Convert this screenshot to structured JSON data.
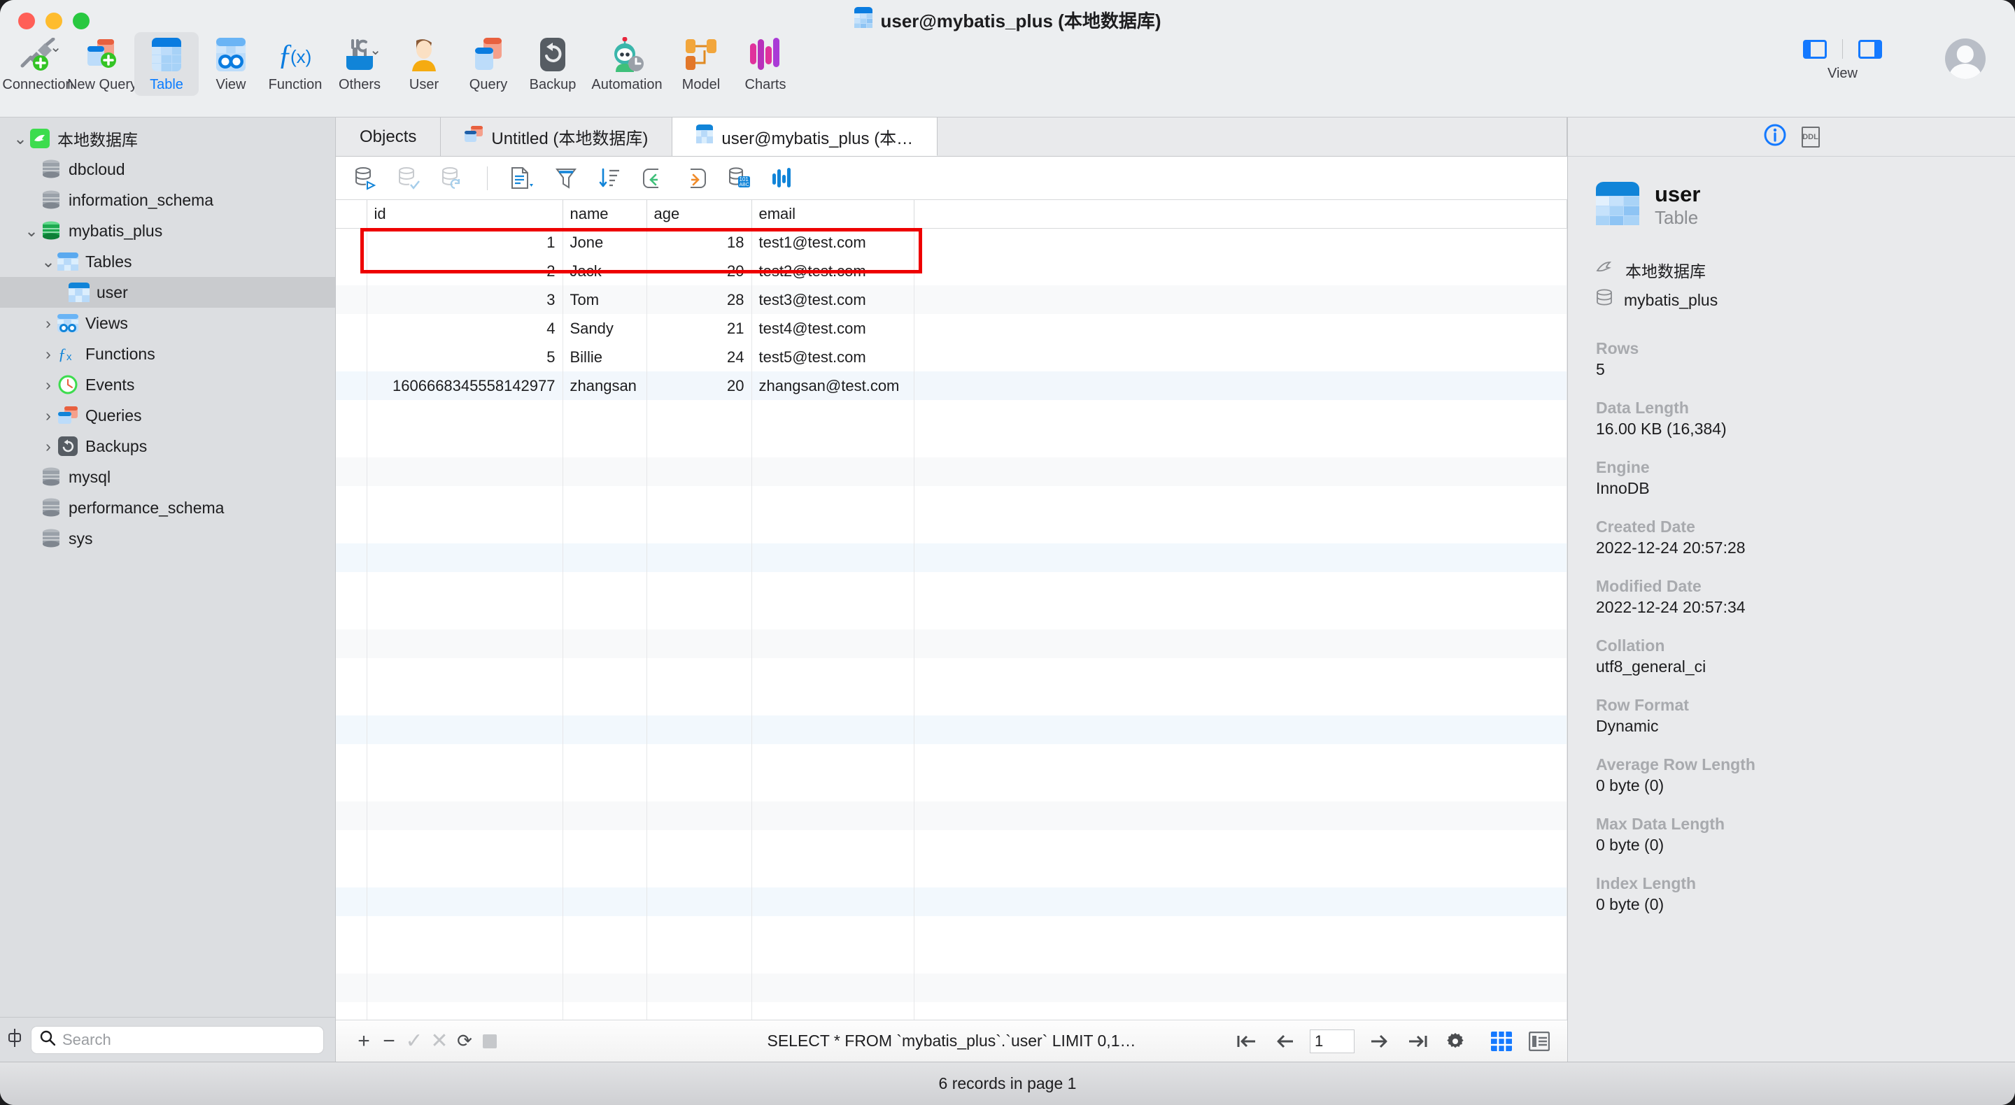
{
  "window": {
    "title": "user@mybatis_plus (本地数据库)",
    "title_icon": "table-icon"
  },
  "toolbar": {
    "items": [
      {
        "label": "Connection",
        "icon": "connection-plug-icon",
        "selected": false,
        "has_chevron": true
      },
      {
        "label": "New Query",
        "icon": "new-query-icon",
        "selected": false,
        "has_chevron": false
      },
      {
        "label": "Table",
        "icon": "table-icon",
        "selected": true,
        "has_chevron": false
      },
      {
        "label": "View",
        "icon": "view-goggles-icon",
        "selected": false,
        "has_chevron": false
      },
      {
        "label": "Function",
        "icon": "function-fx-icon",
        "selected": false,
        "has_chevron": false
      },
      {
        "label": "Others",
        "icon": "others-tools-icon",
        "selected": false,
        "has_chevron": true
      },
      {
        "label": "User",
        "icon": "user-person-icon",
        "selected": false,
        "has_chevron": false
      },
      {
        "label": "Query",
        "icon": "query-icon",
        "selected": false,
        "has_chevron": false
      },
      {
        "label": "Backup",
        "icon": "backup-restore-icon",
        "selected": false,
        "has_chevron": false
      },
      {
        "label": "Automation",
        "icon": "automation-robot-icon",
        "selected": false,
        "has_chevron": false
      },
      {
        "label": "Model",
        "icon": "model-nodes-icon",
        "selected": false,
        "has_chevron": false
      },
      {
        "label": "Charts",
        "icon": "charts-bars-icon",
        "selected": false,
        "has_chevron": false
      }
    ],
    "view_group_label": "View",
    "left_panel_toggle": "toggle-left-sidebar-icon",
    "right_panel_toggle": "toggle-right-sidebar-icon",
    "avatar": "user-avatar-icon"
  },
  "sidebar": {
    "tree": [
      {
        "label": "本地数据库",
        "indent": 0,
        "twisty": "down",
        "icon": "mysql-dolphin-icon",
        "selected": false
      },
      {
        "label": "dbcloud",
        "indent": 1,
        "twisty": "none",
        "icon": "database-gray-icon",
        "selected": false
      },
      {
        "label": "information_schema",
        "indent": 1,
        "twisty": "none",
        "icon": "database-gray-icon",
        "selected": false
      },
      {
        "label": "mybatis_plus",
        "indent": 1,
        "twisty": "down",
        "icon": "database-green-icon",
        "selected": false
      },
      {
        "label": "Tables",
        "indent": 2,
        "twisty": "down",
        "icon": "tables-folder-icon",
        "selected": false
      },
      {
        "label": "user",
        "indent": 3,
        "twisty": "none",
        "icon": "table-icon",
        "selected": true
      },
      {
        "label": "Views",
        "indent": 2,
        "twisty": "right",
        "icon": "views-icon",
        "selected": false
      },
      {
        "label": "Functions",
        "indent": 2,
        "twisty": "right",
        "icon": "functions-fx-icon",
        "selected": false
      },
      {
        "label": "Events",
        "indent": 2,
        "twisty": "right",
        "icon": "events-clock-icon",
        "selected": false
      },
      {
        "label": "Queries",
        "indent": 2,
        "twisty": "right",
        "icon": "queries-icon",
        "selected": false
      },
      {
        "label": "Backups",
        "indent": 2,
        "twisty": "right",
        "icon": "backups-icon",
        "selected": false
      },
      {
        "label": "mysql",
        "indent": 1,
        "twisty": "none",
        "icon": "database-gray-icon",
        "selected": false
      },
      {
        "label": "performance_schema",
        "indent": 1,
        "twisty": "none",
        "icon": "database-gray-icon",
        "selected": false
      },
      {
        "label": "sys",
        "indent": 1,
        "twisty": "none",
        "icon": "database-gray-icon",
        "selected": false
      }
    ],
    "search_placeholder": "Search",
    "search_value": "",
    "resize_handle": "sidebar-resize-icon"
  },
  "tabs": [
    {
      "label": "Objects",
      "icon": "none",
      "active": false
    },
    {
      "label": "Untitled (本地数据库)",
      "icon": "query-icon",
      "active": false
    },
    {
      "label": "user@mybatis_plus (本…",
      "icon": "table-icon",
      "active": true
    }
  ],
  "grid_toolbar": {
    "icons": [
      "run-sql-icon",
      "apply-changes-icon",
      "revert-changes-icon",
      "separator",
      "form-view-icon",
      "filter-icon",
      "sort-icon",
      "undo-icon",
      "redo-icon",
      "raw-value-icon",
      "histogram-icon"
    ]
  },
  "grid": {
    "columns": [
      "id",
      "name",
      "age",
      "email"
    ],
    "rows": [
      {
        "id": "1",
        "name": "Jone",
        "age": "18",
        "email": "test1@test.com"
      },
      {
        "id": "2",
        "name": "Jack",
        "age": "20",
        "email": "test2@test.com"
      },
      {
        "id": "3",
        "name": "Tom",
        "age": "28",
        "email": "test3@test.com"
      },
      {
        "id": "4",
        "name": "Sandy",
        "age": "21",
        "email": "test4@test.com"
      },
      {
        "id": "5",
        "name": "Billie",
        "age": "24",
        "email": "test5@test.com"
      },
      {
        "id": "1606668345558142977",
        "name": "zhangsan",
        "age": "20",
        "email": "zhangsan@test.com"
      }
    ],
    "highlighted_row_index": 5,
    "highlight_color": "#ee0000"
  },
  "grid_bottom": {
    "buttons": [
      "add-row-icon",
      "delete-row-icon",
      "confirm-edit-icon",
      "cancel-edit-icon",
      "refresh-icon",
      "stop-icon"
    ],
    "sql": "SELECT * FROM `mybatis_plus`.`user` LIMIT 0,1…",
    "pager": {
      "first": "first-page-icon",
      "prev": "prev-page-icon",
      "page_value": "1",
      "next": "next-page-icon",
      "last": "last-page-icon",
      "settings": "pager-settings-icon",
      "grid_view": "grid-view-icon",
      "form_view": "form-view-toggle-icon"
    }
  },
  "right_panel": {
    "tabs": [
      "info-icon",
      "ddl-icon"
    ],
    "active_tab": "info-icon",
    "object_name": "user",
    "object_type": "Table",
    "connection": "本地数据库",
    "database": "mybatis_plus",
    "properties": [
      {
        "key": "Rows",
        "value": "5"
      },
      {
        "key": "Data Length",
        "value": "16.00 KB (16,384)"
      },
      {
        "key": "Engine",
        "value": "InnoDB"
      },
      {
        "key": "Created Date",
        "value": "2022-12-24 20:57:28"
      },
      {
        "key": "Modified Date",
        "value": "2022-12-24 20:57:34"
      },
      {
        "key": "Collation",
        "value": "utf8_general_ci"
      },
      {
        "key": "Row Format",
        "value": "Dynamic"
      },
      {
        "key": "Average Row Length",
        "value": "0 byte (0)"
      },
      {
        "key": "Max Data Length",
        "value": "0 byte (0)"
      },
      {
        "key": "Index Length",
        "value": "0 byte (0)"
      }
    ]
  },
  "status_bar": {
    "text": "6 records in page 1"
  }
}
